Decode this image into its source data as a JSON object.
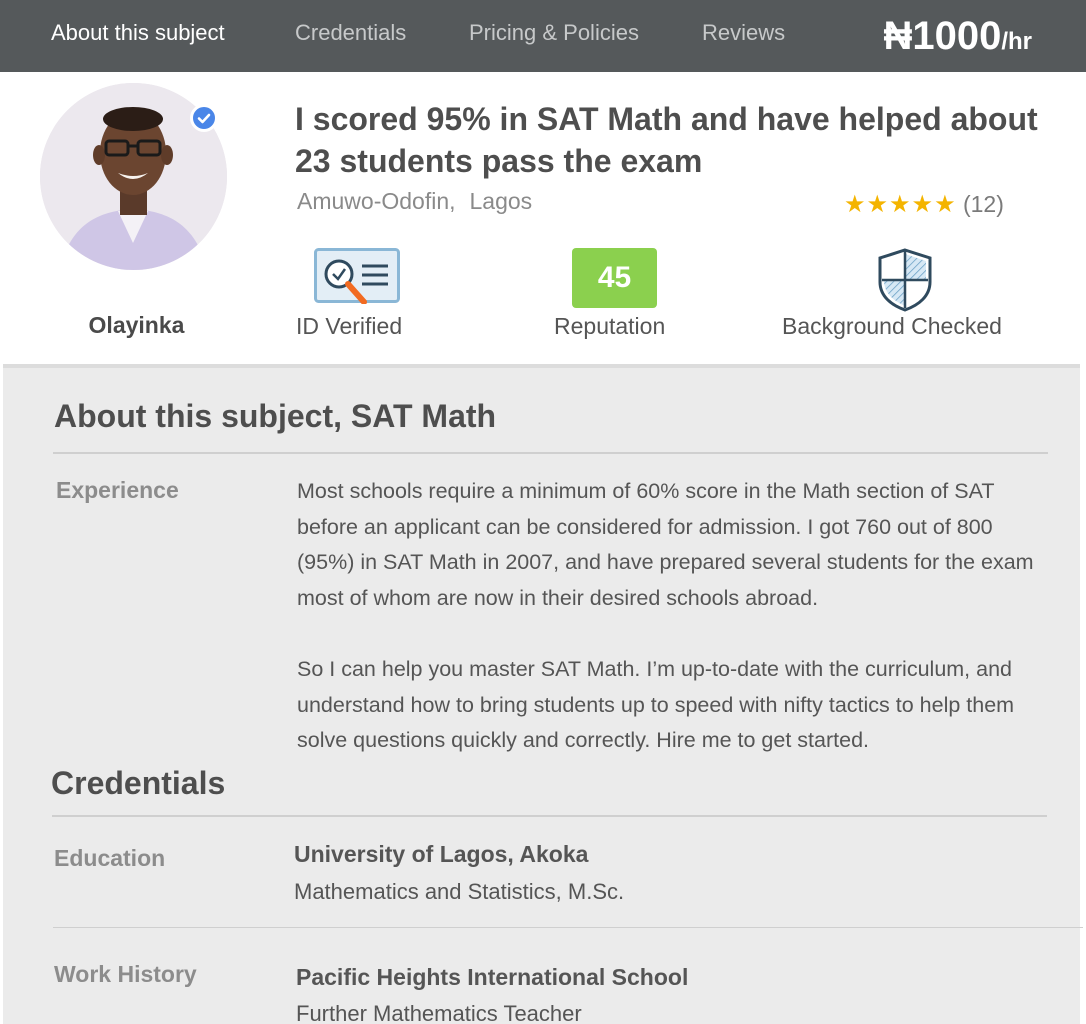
{
  "nav": {
    "tabs": [
      {
        "label": "About this subject",
        "active": true
      },
      {
        "label": "Credentials",
        "active": false
      },
      {
        "label": "Pricing & Policies",
        "active": false
      },
      {
        "label": "Reviews",
        "active": false
      }
    ],
    "price": {
      "currency": "₦",
      "amount": "1000",
      "unit": "/hr"
    }
  },
  "tutor": {
    "name": "Olayinka",
    "headline": "I scored 95% in SAT Math and have helped about 23 students pass the exam",
    "location": {
      "area": "Amuwo-Odofin,",
      "city": "Lagos"
    },
    "rating": {
      "stars": 5,
      "stars_display": "★★★★★",
      "count": "(12)"
    },
    "verified_icon": "check-badge-icon"
  },
  "badges": {
    "id_verified": {
      "label": "ID Verified",
      "icon": "id-card-magnifier-icon"
    },
    "reputation": {
      "label": "Reputation",
      "score": "45"
    },
    "background": {
      "label": "Background Checked",
      "icon": "shield-icon"
    }
  },
  "about": {
    "title": "About this subject, SAT Math",
    "experience_label": "Experience",
    "paragraphs": [
      "Most schools require a minimum of 60% score in the Math section of SAT before an applicant can be considered for admission. I got 760 out of 800 (95%) in SAT Math in 2007, and have prepared several students for the exam most of whom are now in their desired schools abroad.",
      "So I can help you master SAT Math. I’m up-to-date with the curriculum, and understand how to bring students up to speed with nifty tactics to help them solve questions quickly and correctly. Hire me to get started."
    ]
  },
  "credentials": {
    "title": "Credentials",
    "education_label": "Education",
    "education": {
      "school": "University of Lagos, Akoka",
      "degree": "Mathematics and Statistics, M.Sc."
    },
    "work_label": "Work History",
    "work": {
      "employer": "Pacific Heights International School",
      "role": "Further Mathematics Teacher"
    }
  },
  "colors": {
    "nav_bg": "#55595b",
    "reputation_green": "#8bd04e",
    "star_gold": "#f4b400",
    "verified_blue": "#4a86e8",
    "panel_bg": "#ebebeb"
  }
}
